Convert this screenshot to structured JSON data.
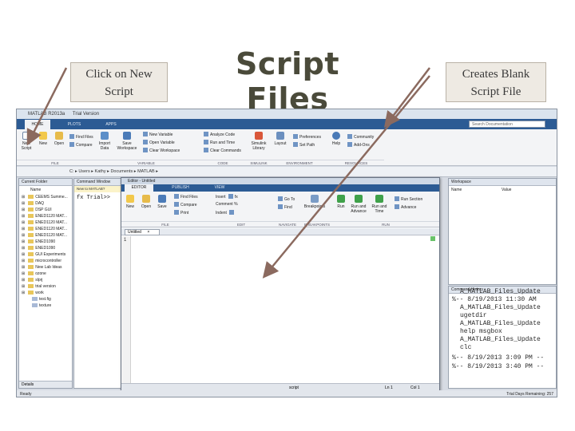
{
  "slide": {
    "title": "Script Files",
    "callout_left": "Click on New Script",
    "callout_right": "Creates Blank Script File"
  },
  "colors": {
    "arrow": "#8b6a5f",
    "toolstrip": "#2c5b94",
    "callout_bg": "#eeeae3"
  },
  "matlab": {
    "window_title": "MATLAB R2013a",
    "license": "Trial Version",
    "tabs": [
      "HOME",
      "PLOTS",
      "APPS"
    ],
    "search_placeholder": "Search Documentation",
    "ribbon": {
      "new_script": "New Script",
      "new": "New",
      "open": "Open",
      "find_files": "Find Files",
      "compare": "Compare",
      "import_data": "Import Data",
      "save_workspace": "Save Workspace",
      "new_variable": "New Variable",
      "open_variable": "Open Variable",
      "clear_workspace": "Clear Workspace",
      "analyze_code": "Analyze Code",
      "run_and_time": "Run and Time",
      "clear_commands": "Clear Commands",
      "simulink_library": "Simulink Library",
      "layout": "Layout",
      "preferences": "Preferences",
      "set_path": "Set Path",
      "help": "Help",
      "community": "Community",
      "add_ons": "Add-Ons",
      "sections": [
        "FILE",
        "VARIABLE",
        "CODE",
        "SIMULINK",
        "ENVIRONMENT",
        "RESOURCES"
      ]
    },
    "path": [
      "C:",
      "Users",
      "Kathy",
      "Documents",
      "MATLAB"
    ],
    "current_folder": {
      "title": "Current Folder",
      "column": "Name",
      "items": [
        "CEEMS Summe...",
        "DAQ",
        "DSP GUI",
        "ENED1120 MAT...",
        "ENED1120 MAT...",
        "ENED1120 MAT...",
        "ENED1120 MAT...",
        "ENED1090",
        "ENED1090",
        "GUI Experiments",
        "microcontroller",
        "New Lab Ideas",
        "ozone",
        "slprj",
        "trial version",
        "work",
        "test.fig",
        "texture"
      ],
      "details": "Details"
    },
    "command_window": {
      "title": "Command Window",
      "new_notice": "New to MATLAB?",
      "prompt": "fx Trial>>"
    },
    "editor": {
      "title": "Editor - Untitled",
      "tabs": [
        "EDITOR",
        "PUBLISH",
        "VIEW"
      ],
      "buttons": {
        "new": "New",
        "open": "Open",
        "save": "Save",
        "find_files": "Find Files",
        "compare": "Compare",
        "print": "Print",
        "insert": "Insert",
        "comment": "Comment",
        "indent": "Indent",
        "go_to": "Go To",
        "find": "Find",
        "breakpoints": "Breakpoints",
        "run": "Run",
        "run_and_advance": "Run and Advance",
        "run_section": "Run Section",
        "advance": "Advance",
        "run_and_time": "Run and Time"
      },
      "sections": [
        "FILE",
        "EDIT",
        "NAVIGATE",
        "BREAKPOINTS",
        "RUN"
      ],
      "doc_tab": "Untitled",
      "line_number": "1",
      "status_script": "script",
      "status_ln": "Ln 1",
      "status_col": "Col 1"
    },
    "workspace": {
      "title": "Workspace",
      "col_name": "Name",
      "col_value": "Value"
    },
    "command_history": {
      "title": "Command History",
      "lines": [
        "A_MATLAB_Files_Update",
        "%-- 8/19/2013 11:30 AM",
        "A_MATLAB_Files_Update",
        "ugetdir",
        "A_MATLAB_Files_Update",
        "help msgbox",
        "A_MATLAB_Files_Update",
        "clc",
        "%-- 8/19/2013 3:09 PM --",
        "%-- 8/19/2013 3:40 PM --"
      ]
    },
    "status": {
      "left": "Ready",
      "right": "Trial Days Remaining: 257"
    }
  }
}
